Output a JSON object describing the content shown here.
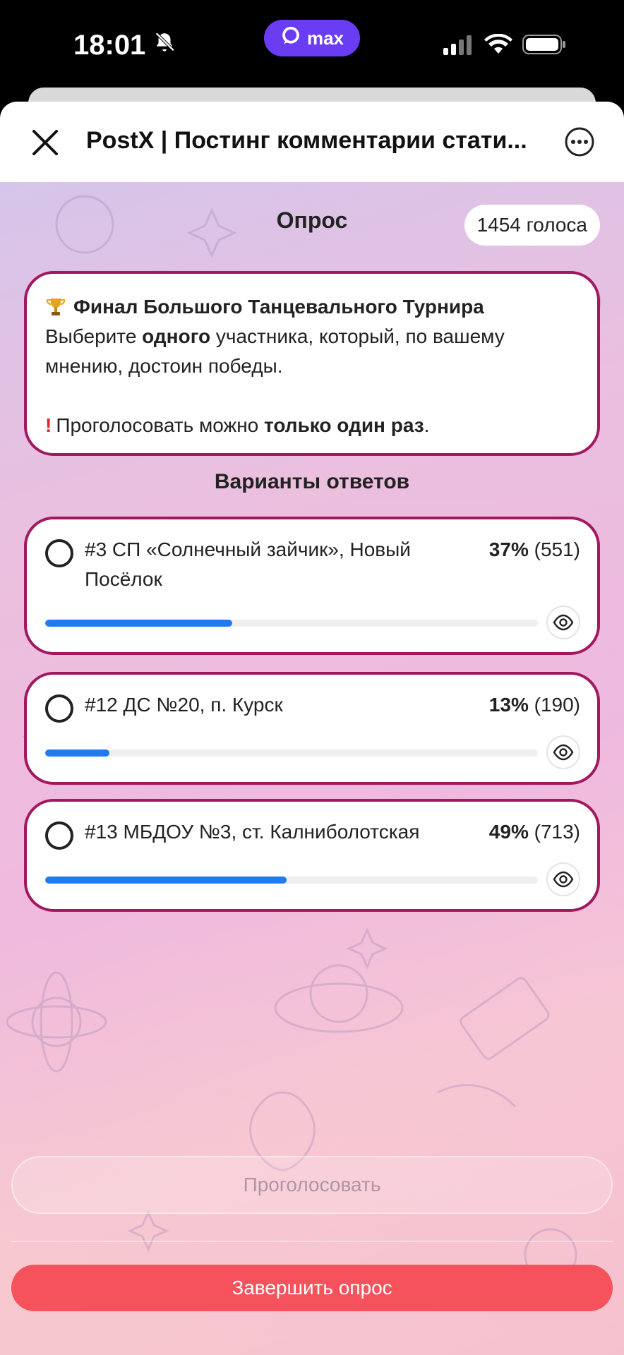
{
  "status_bar": {
    "time": "18:01",
    "pill_label": "max"
  },
  "header": {
    "title": "PostX | Постинг комментарии стати..."
  },
  "poll": {
    "label": "Опрос",
    "votes": "1454 голоса",
    "question": {
      "title": "Финал Большого Танцевального Турнира",
      "line1_prefix": "Выберите ",
      "line1_bold": "одного",
      "line1_suffix": " участника, который, по вашему мнению, достоин победы.",
      "note_prefix": "Проголосовать можно ",
      "note_bold": "только один раз",
      "note_suffix": "."
    },
    "options_label": "Варианты ответов",
    "options": [
      {
        "text": "#3 СП «Солнечный зайчик», Новый Посёлок",
        "percent_label": "37%",
        "count_label": "(551)",
        "fraction": 0.38
      },
      {
        "text": "#12 ДС №20, п. Курск",
        "percent_label": "13%",
        "count_label": "(190)",
        "fraction": 0.13
      },
      {
        "text": "#13 МБДОУ №3, ст. Калниболотская",
        "percent_label": "49%",
        "count_label": "(713)",
        "fraction": 0.49
      }
    ],
    "vote_button": "Проголосовать",
    "finish_button": "Завершить опрос"
  },
  "colors": {
    "accent_border": "#a3175e",
    "bar_fill": "#1f7cf0",
    "finish_button": "#f6525b",
    "status_pill": "#6a3df5"
  }
}
